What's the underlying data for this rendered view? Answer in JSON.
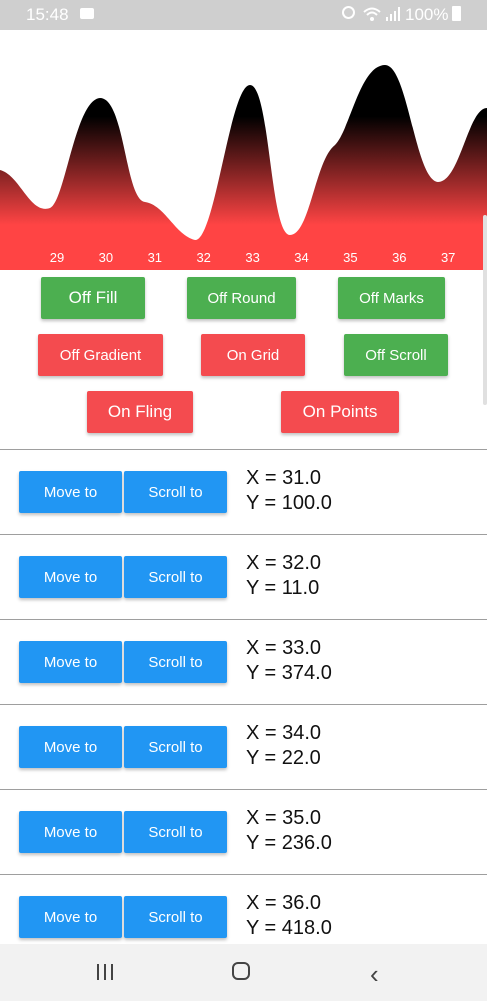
{
  "status_bar": {
    "time": "15:48",
    "battery": "100%"
  },
  "chart_data": {
    "type": "area",
    "x_ticks": [
      "29",
      "30",
      "31",
      "32",
      "33",
      "34",
      "35",
      "36",
      "37"
    ],
    "gradient_top": "#000000",
    "gradient_bottom": "#ff4444"
  },
  "controls": {
    "row1": [
      "Off Fill",
      "Off Round",
      "Off Marks"
    ],
    "row2": [
      "Off Gradient",
      "On Grid",
      "Off Scroll"
    ],
    "row3": [
      "On Fling",
      "On Points"
    ]
  },
  "points": [
    {
      "move": "Move to",
      "scroll": "Scroll to",
      "x": "X = 31.0",
      "y": "Y = 100.0"
    },
    {
      "move": "Move to",
      "scroll": "Scroll to",
      "x": "X = 32.0",
      "y": "Y = 11.0"
    },
    {
      "move": "Move to",
      "scroll": "Scroll to",
      "x": "X = 33.0",
      "y": "Y = 374.0"
    },
    {
      "move": "Move to",
      "scroll": "Scroll to",
      "x": "X = 34.0",
      "y": "Y = 22.0"
    },
    {
      "move": "Move to",
      "scroll": "Scroll to",
      "x": "X = 35.0",
      "y": "Y = 236.0"
    },
    {
      "move": "Move to",
      "scroll": "Scroll to",
      "x": "X = 36.0",
      "y": "Y = 418.0"
    }
  ]
}
